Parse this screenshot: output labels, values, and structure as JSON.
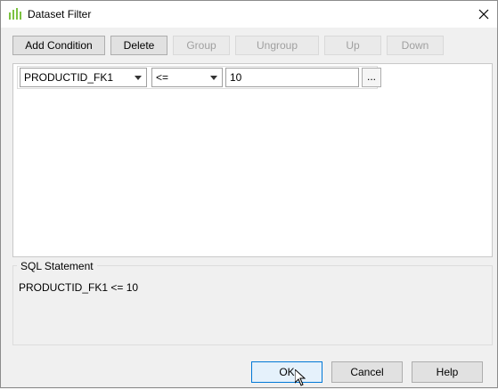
{
  "window": {
    "title": "Dataset Filter"
  },
  "toolbar": {
    "add_condition": "Add Condition",
    "delete": "Delete",
    "group": "Group",
    "ungroup": "Ungroup",
    "up": "Up",
    "down": "Down"
  },
  "condition": {
    "field": "PRODUCTID_FK1",
    "operator": "<=",
    "value": "10",
    "ellipsis": "..."
  },
  "sql": {
    "label": "SQL Statement",
    "statement": "PRODUCTID_FK1 <= 10"
  },
  "footer": {
    "ok": "OK",
    "cancel": "Cancel",
    "help": "Help"
  },
  "colors": {
    "accent": "#0078d7",
    "icon_green": "#5cb85c"
  }
}
